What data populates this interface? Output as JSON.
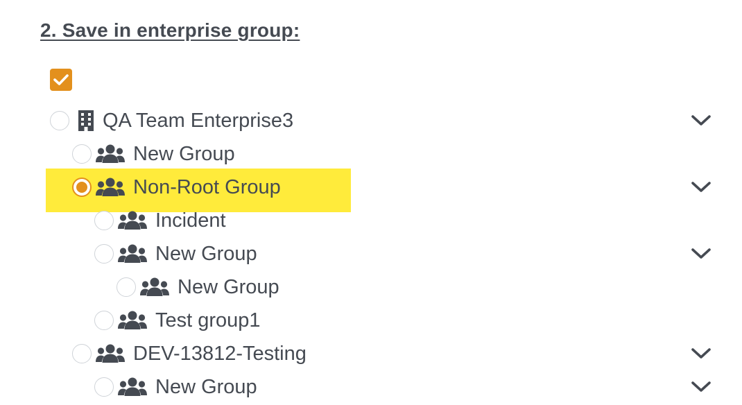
{
  "section": {
    "title": "2. Save in enterprise group:"
  },
  "select_all": {
    "checked": true
  },
  "tree": {
    "nodes": [
      {
        "label": "QA Team Enterprise3",
        "icon": "building-icon",
        "depth": 0,
        "selected": false,
        "expandable": true
      },
      {
        "label": "New Group",
        "icon": "users-icon",
        "depth": 1,
        "selected": false,
        "expandable": false
      },
      {
        "label": "Non-Root Group",
        "icon": "users-icon",
        "depth": 1,
        "selected": true,
        "expandable": true
      },
      {
        "label": "Incident",
        "icon": "users-icon",
        "depth": 2,
        "selected": false,
        "expandable": false
      },
      {
        "label": "New Group",
        "icon": "users-icon",
        "depth": 2,
        "selected": false,
        "expandable": true
      },
      {
        "label": "New Group",
        "icon": "users-icon",
        "depth": 3,
        "selected": false,
        "expandable": false
      },
      {
        "label": "Test group1",
        "icon": "users-icon",
        "depth": 2,
        "selected": false,
        "expandable": false
      },
      {
        "label": "DEV-13812-Testing",
        "icon": "users-icon",
        "depth": 1,
        "selected": false,
        "expandable": true
      },
      {
        "label": "New Group",
        "icon": "users-icon",
        "depth": 2,
        "selected": false,
        "expandable": true
      }
    ]
  },
  "colors": {
    "accent": "#e3901d",
    "highlight": "#ffeb3b",
    "text": "#454a52"
  }
}
